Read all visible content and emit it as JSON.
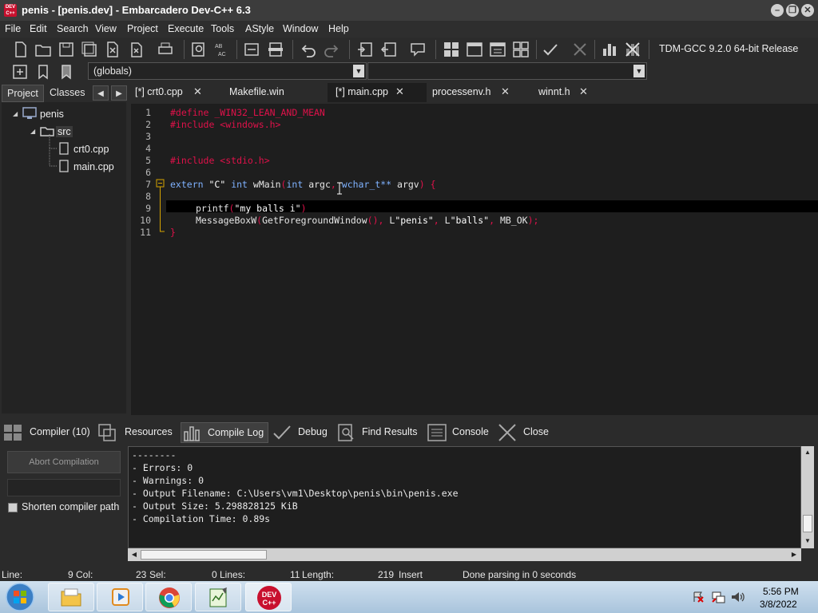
{
  "window": {
    "title": "penis - [penis.dev] - Embarcadero Dev-C++ 6.3",
    "logo_text": "DEV C++"
  },
  "menu": [
    "File",
    "Edit",
    "Search",
    "View",
    "Project",
    "Execute",
    "Tools",
    "AStyle",
    "Window",
    "Help"
  ],
  "toolbar": {
    "compiler_label": "TDM-GCC 9.2.0 64-bit Release",
    "scope_combo": "(globals)"
  },
  "left_panel": {
    "tabs": [
      "Project",
      "Classes"
    ],
    "tree": {
      "project": "penis",
      "folder": "src",
      "files": [
        "crt0.cpp",
        "main.cpp"
      ]
    }
  },
  "editor": {
    "tabs": [
      "[*] crt0.cpp",
      "Makefile.win",
      "[*] main.cpp",
      "processenv.h",
      "winnt.h"
    ],
    "line_numbers": [
      "1",
      "2",
      "3",
      "4",
      "5",
      "6",
      "7",
      "8",
      "9",
      "10",
      "11"
    ],
    "code": {
      "l1": "#define _WIN32_LEAN_AND_MEAN",
      "l2": "#include <windows.h>",
      "l5": "#include <stdio.h>",
      "l7_kw1": "extern",
      "l7_str": "\"C\"",
      "l7_kw2": "int",
      "l7_fn": "wMain",
      "l7_p1": "(",
      "l7_kw3": "int",
      "l7_arg1": "argc",
      "l7_comma": ",",
      "l7_type": "wchar_t**",
      "l7_arg2": "argv",
      "l7_p2": ") {",
      "l9_fn": "printf",
      "l9_p": "(",
      "l9_str": "\"my balls i\"",
      "l9_p2": ")",
      "l10_fn": "MessageBoxW",
      "l10_p1": "(",
      "l10_call": "GetForegroundWindow",
      "l10_p2": "(),",
      "l10_L1": "L",
      "l10_s1": "\"penis\"",
      "l10_c1": ",",
      "l10_L2": "L",
      "l10_s2": "\"balls\"",
      "l10_c2": ",",
      "l10_mb": "MB_OK",
      "l10_end": ");",
      "l11": "}"
    }
  },
  "bottom_tabs": [
    "Compiler (10)",
    "Resources",
    "Compile Log",
    "Debug",
    "Find Results",
    "Console",
    "Close"
  ],
  "compile_panel": {
    "abort_label": "Abort Compilation",
    "shorten_label": "Shorten compiler path",
    "log": [
      "--------",
      "- Errors: 0",
      "- Warnings: 0",
      "- Output Filename: C:\\Users\\vm1\\Desktop\\penis\\bin\\penis.exe",
      "- Output Size: 5.298828125 KiB",
      "- Compilation Time: 0.89s"
    ]
  },
  "status": {
    "line_label": "Line:",
    "line_value": "9",
    "col_label": "Col:",
    "col_value": "23",
    "sel_label": "Sel:",
    "sel_value": "0",
    "lines_label": "Lines:",
    "lines_value": "11",
    "length_label": "Length:",
    "length_value": "219",
    "mode": "Insert",
    "message": "Done parsing in 0 seconds"
  },
  "taskbar": {
    "time": "5:56 PM",
    "date": "3/8/2022"
  }
}
